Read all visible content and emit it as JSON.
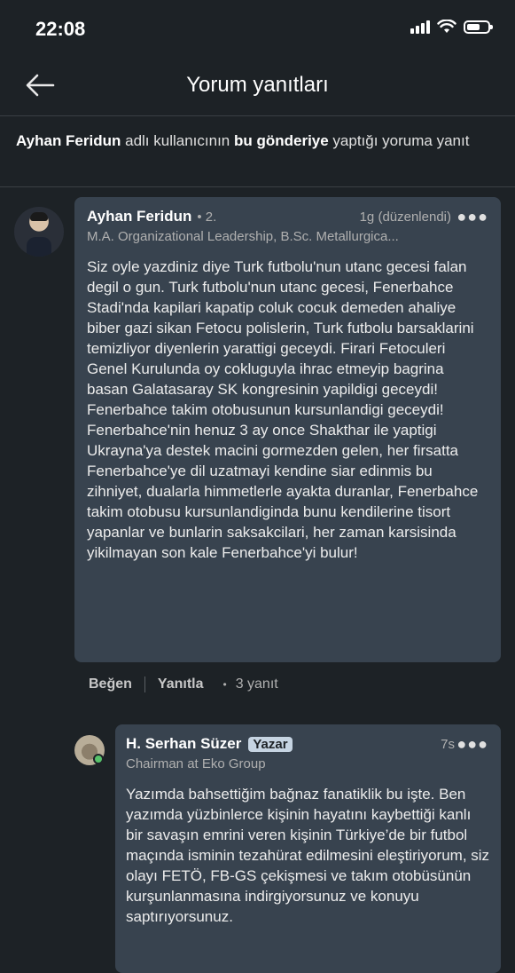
{
  "status_bar": {
    "time": "22:08"
  },
  "header": {
    "title": "Yorum yanıtları"
  },
  "context": {
    "author": "Ayhan Feridun",
    "text1": " adlı kullanıcının ",
    "post": "bu gönderiye",
    "text2": " yaptığı yoruma yanıt"
  },
  "comment": {
    "author": "Ayhan Feridun",
    "degree": "• 2.",
    "time": "1g (düzenlendi)",
    "headline": "M.A. Organizational Leadership, B.Sc. Metallurgica...",
    "body": "Siz oyle yazdiniz diye Turk futbolu'nun utanc gecesi falan degil o gun. Turk futbolu'nun utanc gecesi, Fenerbahce Stadi'nda kapilari kapatip coluk cocuk demeden ahaliye biber gazi sikan Fetocu polislerin, Turk futbolu barsaklarini temizliyor diyenlerin yarattigi geceydi. Firari Fetoculeri Genel Kurulunda oy cokluguyla ihrac etmeyip bagrina basan Galatasaray SK kongresinin yapildigi geceydi! Fenerbahce takim otobusunun kursunlandigi geceydi! Fenerbahce'nin henuz 3 ay once Shakthar ile yaptigi Ukrayna'ya destek macini gormezden gelen, her firsatta Fenerbahce'ye dil uzatmayi kendine siar edinmis bu zihniyet, dualarla himmetlerle ayakta duranlar, Fenerbahce takim otobusu kursunlandiginda bunu kendilerine tisort yapanlar ve bunlarin saksakcilari, her zaman karsisinda yikilmayan son kale Fenerbahce'yi bulur!",
    "actions": {
      "like": "Beğen",
      "reply": "Yanıtla",
      "reply_count": "3 yanıt"
    }
  },
  "reply": {
    "author": "H. Serhan Süzer",
    "badge": "Yazar",
    "time": "7s",
    "headline": "Chairman at Eko Group",
    "body": "Yazımda bahsettiğim bağnaz fanatiklik bu işte. Ben yazımda yüzbinlerce kişinin hayatını kaybettiği kanlı bir savaşın emrini veren kişinin Türkiye’de bir futbol maçında isminin tezahürat edilmesini eleştiriyorum, siz olayı FETÖ, FB-GS çekişmesi ve takım otobüsünün kurşunlanmasına indirgiyorsunuz ve konuyu saptırıyorsunuz."
  }
}
